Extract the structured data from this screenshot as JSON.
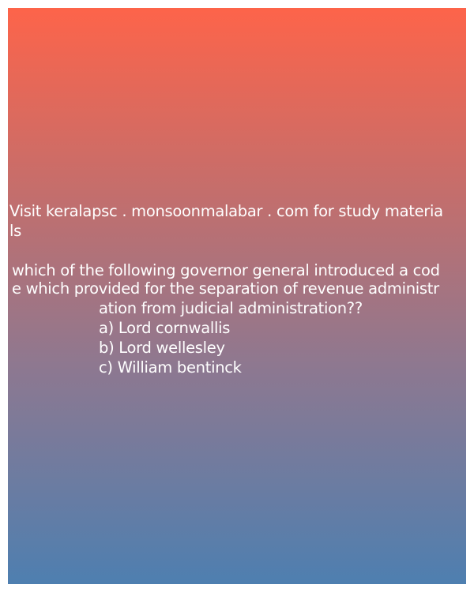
{
  "promo": {
    "line1": "Visit keralapsc . monsoonmalabar . com for study materia",
    "line2": "ls"
  },
  "question": {
    "line1": "which of the following governor general introduced a cod",
    "line2": "e which provided for the separation of revenue administr",
    "line3": "ation from judicial administration??"
  },
  "options": [
    {
      "label": "a) Lord cornwallis"
    },
    {
      "label": "b) Lord wellesley"
    },
    {
      "label": "c) William bentinck"
    }
  ],
  "colors": {
    "gradient_top": "#fd644a",
    "gradient_bottom": "#4e7fb0",
    "text": "#ffffff"
  }
}
